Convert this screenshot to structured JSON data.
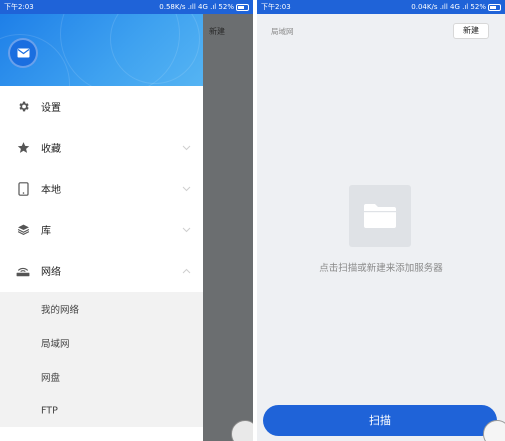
{
  "left": {
    "status": {
      "time": "下午2:03",
      "stats": "0.58K/s .ıll 4G .ıl 52%"
    },
    "underlying_new_label": "新建",
    "drawer": {
      "menu": [
        {
          "label": "设置",
          "icon": "gear-icon"
        },
        {
          "label": "收藏",
          "icon": "star-icon"
        },
        {
          "label": "本地",
          "icon": "phone-icon"
        },
        {
          "label": "库",
          "icon": "stack-icon"
        },
        {
          "label": "网络",
          "icon": "router-icon"
        }
      ],
      "network_sub": [
        "我的网络",
        "局域网",
        "网盘",
        "FTP"
      ]
    }
  },
  "right": {
    "status": {
      "time": "下午2:03",
      "stats": "0.04K/s .ıll 4G .ıl 52%"
    },
    "title": "局域网",
    "new_button": "新建",
    "empty_message": "点击扫描或新建来添加服务器",
    "scan_button": "扫描"
  },
  "colors": {
    "accent": "#1f63d8",
    "drawer_header": "#3fa2f0",
    "dim_overlay": "#6b6e70"
  }
}
